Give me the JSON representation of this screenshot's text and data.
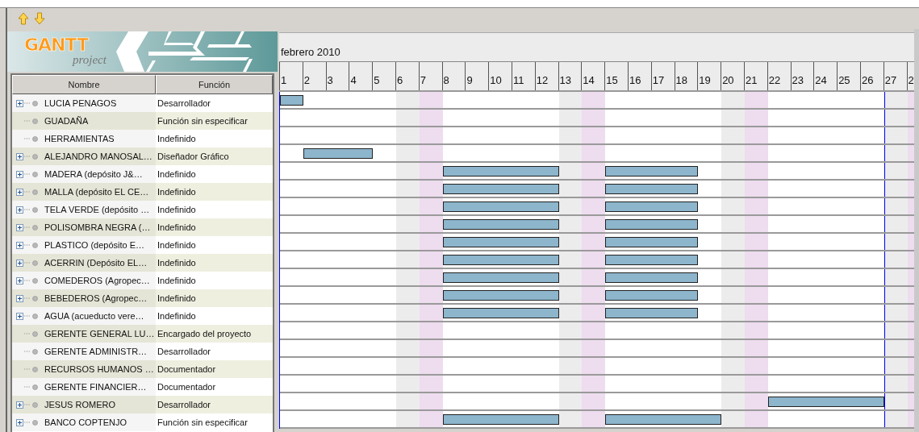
{
  "toolbar": {
    "buttons": [
      {
        "kind": "up"
      },
      {
        "kind": "down"
      }
    ]
  },
  "logo": {
    "title": "GANTT",
    "subtitle": "project"
  },
  "table": {
    "columns": [
      "Nombre",
      "Función"
    ],
    "rows": [
      {
        "name": "LUCIA PENAGOS",
        "role": "Desarrollador",
        "has_children": true,
        "busy": [
          true,
          false,
          false,
          false,
          false,
          false,
          false,
          false,
          false,
          false,
          false,
          false,
          false,
          false,
          false,
          false,
          false,
          false,
          false,
          false,
          false,
          false,
          false,
          false,
          false,
          false,
          false,
          false
        ]
      },
      {
        "name": "GUADAÑA",
        "role": "Función sin especificar",
        "has_children": false
      },
      {
        "name": "HERRAMIENTAS",
        "role": "Indefinido",
        "has_children": false
      },
      {
        "name": "ALEJANDRO MANOSAL…",
        "role": "Diseñador Gráfico",
        "has_children": true,
        "busy": [
          false,
          true,
          true,
          true,
          false,
          false,
          false,
          false,
          false,
          false,
          false,
          false,
          false,
          false,
          false,
          false,
          false,
          false,
          false,
          false,
          false,
          false,
          false,
          false,
          false,
          false,
          false,
          false
        ]
      },
      {
        "name": "MADERA (depósito J&…",
        "role": "Indefinido",
        "has_children": true,
        "busy": [
          false,
          false,
          false,
          false,
          false,
          false,
          false,
          true,
          true,
          true,
          true,
          true,
          false,
          false,
          true,
          true,
          true,
          true,
          false,
          false,
          false,
          false,
          false,
          false,
          false,
          false,
          false,
          false
        ]
      },
      {
        "name": "MALLA (depósito EL CE…",
        "role": "Indefinido",
        "has_children": true,
        "busy": [
          false,
          false,
          false,
          false,
          false,
          false,
          false,
          true,
          true,
          true,
          true,
          true,
          false,
          false,
          true,
          true,
          true,
          true,
          false,
          false,
          false,
          false,
          false,
          false,
          false,
          false,
          false,
          false
        ]
      },
      {
        "name": "TELA VERDE (depósito …",
        "role": "Indefinido",
        "has_children": true,
        "busy": [
          false,
          false,
          false,
          false,
          false,
          false,
          false,
          true,
          true,
          true,
          true,
          true,
          false,
          false,
          true,
          true,
          true,
          true,
          false,
          false,
          false,
          false,
          false,
          false,
          false,
          false,
          false,
          false
        ]
      },
      {
        "name": "POLISOMBRA NEGRA (…",
        "role": "Indefinido",
        "has_children": true,
        "busy": [
          false,
          false,
          false,
          false,
          false,
          false,
          false,
          true,
          true,
          true,
          true,
          true,
          false,
          false,
          true,
          true,
          true,
          true,
          false,
          false,
          false,
          false,
          false,
          false,
          false,
          false,
          false,
          false
        ]
      },
      {
        "name": "PLASTICO (depósito E…",
        "role": "Indefinido",
        "has_children": true,
        "busy": [
          false,
          false,
          false,
          false,
          false,
          false,
          false,
          true,
          true,
          true,
          true,
          true,
          false,
          false,
          true,
          true,
          true,
          true,
          false,
          false,
          false,
          false,
          false,
          false,
          false,
          false,
          false,
          false
        ]
      },
      {
        "name": "ACERRIN (Depósito EL…",
        "role": "Indefinido",
        "has_children": true,
        "busy": [
          false,
          false,
          false,
          false,
          false,
          false,
          false,
          true,
          true,
          true,
          true,
          true,
          false,
          false,
          true,
          true,
          true,
          true,
          false,
          false,
          false,
          false,
          false,
          false,
          false,
          false,
          false,
          false
        ]
      },
      {
        "name": "COMEDEROS (Agropec…",
        "role": "Indefinido",
        "has_children": true,
        "busy": [
          false,
          false,
          false,
          false,
          false,
          false,
          false,
          true,
          true,
          true,
          true,
          true,
          false,
          false,
          true,
          true,
          true,
          true,
          false,
          false,
          false,
          false,
          false,
          false,
          false,
          false,
          false,
          false
        ]
      },
      {
        "name": "BEBEDEROS (Agropec…",
        "role": "Indefinido",
        "has_children": true,
        "busy": [
          false,
          false,
          false,
          false,
          false,
          false,
          false,
          true,
          true,
          true,
          true,
          true,
          false,
          false,
          true,
          true,
          true,
          true,
          false,
          false,
          false,
          false,
          false,
          false,
          false,
          false,
          false,
          false
        ]
      },
      {
        "name": "AGUA (acueducto vere…",
        "role": "Indefinido",
        "has_children": true,
        "busy": [
          false,
          false,
          false,
          false,
          false,
          false,
          false,
          true,
          true,
          true,
          true,
          true,
          false,
          false,
          true,
          true,
          true,
          true,
          false,
          false,
          false,
          false,
          false,
          false,
          false,
          false,
          false,
          false
        ]
      },
      {
        "name": "GERENTE GENERAL LU…",
        "role": "Encargado del proyecto",
        "has_children": false
      },
      {
        "name": "GERENTE ADMINISTR…",
        "role": "Desarrollador",
        "has_children": false
      },
      {
        "name": "RECURSOS HUMANOS …",
        "role": "Documentador",
        "has_children": false
      },
      {
        "name": "GERENTE FINANCIER…",
        "role": "Documentador",
        "has_children": false
      },
      {
        "name": "JESUS ROMERO",
        "role": "Desarrollador",
        "has_children": true,
        "busy": [
          false,
          false,
          false,
          false,
          false,
          false,
          false,
          false,
          false,
          false,
          false,
          false,
          false,
          false,
          false,
          false,
          false,
          false,
          false,
          false,
          false,
          true,
          true,
          true,
          true,
          true,
          false,
          false
        ]
      },
      {
        "name": "BANCO COPTENJO",
        "role": "Función sin especificar",
        "has_children": true,
        "busy": [
          false,
          false,
          false,
          false,
          false,
          false,
          false,
          true,
          true,
          true,
          true,
          true,
          false,
          false,
          true,
          true,
          true,
          true,
          true,
          false,
          false,
          false,
          false,
          false,
          false,
          false,
          false,
          false
        ]
      }
    ]
  },
  "timeline": {
    "month": "febrero 2010",
    "days": [
      {
        "label": "1",
        "kind": "weekday",
        "today": false
      },
      {
        "label": "2",
        "kind": "weekday",
        "today": false
      },
      {
        "label": "3",
        "kind": "weekday",
        "today": false
      },
      {
        "label": "4",
        "kind": "weekday",
        "today": false
      },
      {
        "label": "5",
        "kind": "weekday",
        "today": false
      },
      {
        "label": "6",
        "kind": "saturday",
        "today": false
      },
      {
        "label": "7",
        "kind": "sunday",
        "today": false
      },
      {
        "label": "8",
        "kind": "weekday",
        "today": false
      },
      {
        "label": "9",
        "kind": "weekday",
        "today": false
      },
      {
        "label": "10",
        "kind": "weekday",
        "today": false
      },
      {
        "label": "11",
        "kind": "weekday",
        "today": false
      },
      {
        "label": "12",
        "kind": "weekday",
        "today": false
      },
      {
        "label": "13",
        "kind": "saturday",
        "today": false
      },
      {
        "label": "14",
        "kind": "sunday",
        "today": false
      },
      {
        "label": "15",
        "kind": "weekday",
        "today": false
      },
      {
        "label": "16",
        "kind": "weekday",
        "today": false
      },
      {
        "label": "17",
        "kind": "weekday",
        "today": false
      },
      {
        "label": "18",
        "kind": "weekday",
        "today": false
      },
      {
        "label": "19",
        "kind": "weekday",
        "today": false
      },
      {
        "label": "20",
        "kind": "saturday",
        "today": false
      },
      {
        "label": "21",
        "kind": "sunday",
        "today": false
      },
      {
        "label": "22",
        "kind": "weekday",
        "today": false
      },
      {
        "label": "23",
        "kind": "weekday",
        "today": false
      },
      {
        "label": "24",
        "kind": "weekday",
        "today": false
      },
      {
        "label": "25",
        "kind": "weekday",
        "today": false
      },
      {
        "label": "26",
        "kind": "weekday",
        "today": false
      },
      {
        "label": "27",
        "kind": "saturday",
        "today": true
      },
      {
        "label": "2",
        "kind": "sunday",
        "today": false
      }
    ]
  }
}
